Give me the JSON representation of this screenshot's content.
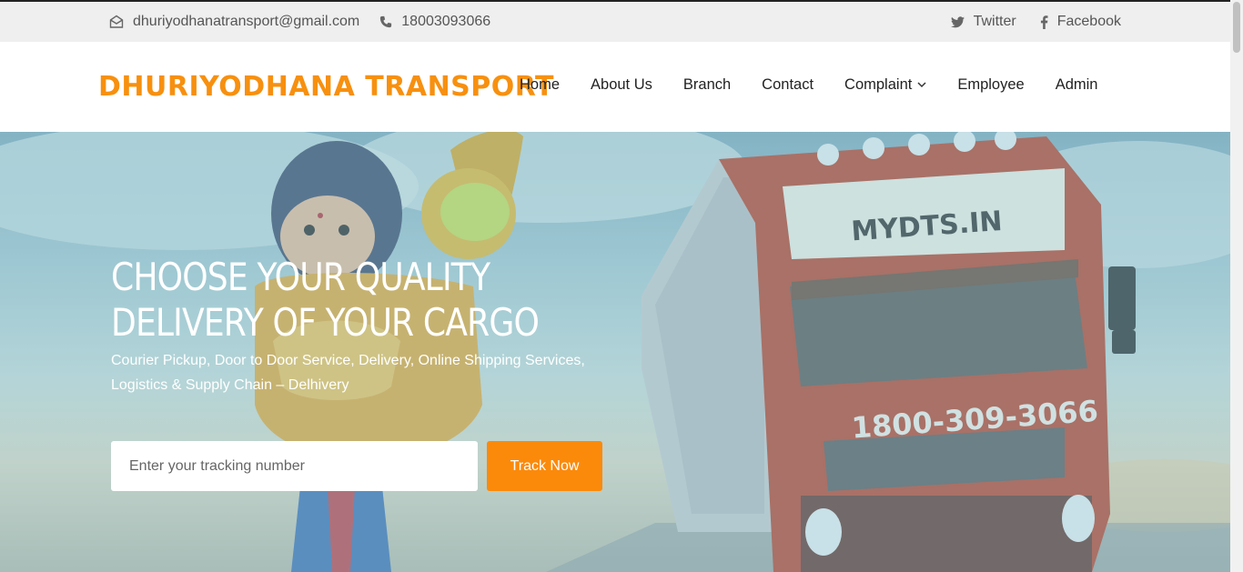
{
  "topbar": {
    "email": "dhuriyodhanatransport@gmail.com",
    "phone": "18003093066",
    "twitter": "Twitter",
    "facebook": "Facebook"
  },
  "header": {
    "brand": "DHURIYODHANA TRANSPORT",
    "nav": [
      "Home",
      "About Us",
      "Branch",
      "Contact",
      "Complaint",
      "Employee",
      "Admin"
    ]
  },
  "hero": {
    "title": "CHOOSE YOUR QUALITY DELIVERY OF YOUR CARGO",
    "subtitle": "Courier Pickup, Door to Door Service, Delivery, Online Shipping Services, Logistics & Supply Chain – Delhivery",
    "tracking_placeholder": "Enter your tracking number",
    "track_button": "Track Now",
    "truck_sign": "MYDTS.IN",
    "truck_phone": "1800-309-3066"
  },
  "colors": {
    "accent": "#fb8a0b",
    "brand": "#f7900f"
  },
  "icons": [
    "envelope-icon",
    "phone-icon",
    "twitter-icon",
    "facebook-icon",
    "chevron-down-icon"
  ]
}
